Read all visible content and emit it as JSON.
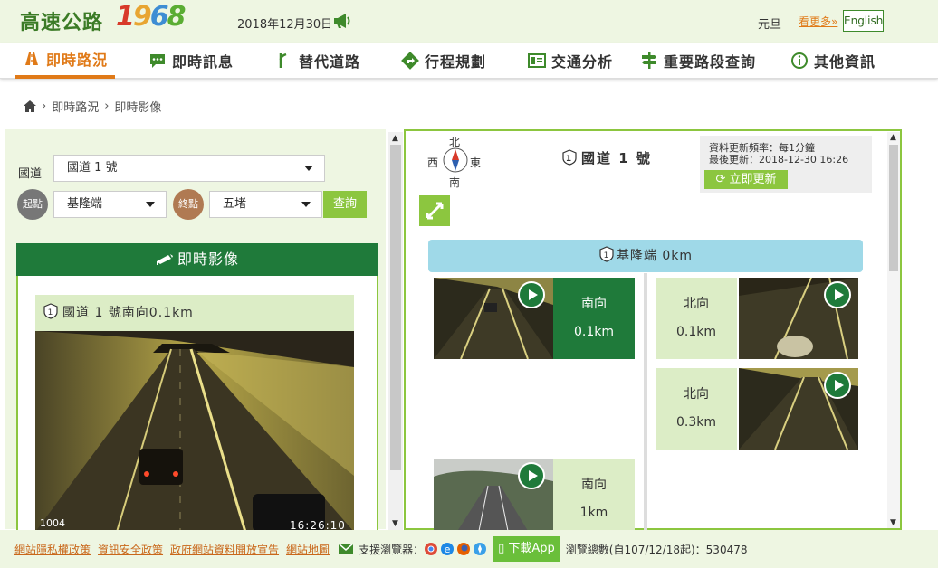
{
  "header": {
    "logo_text": "高速公路",
    "logo_digits": [
      "1",
      "9",
      "6",
      "8"
    ],
    "date": "2018年12月30日",
    "holiday": "元旦",
    "more_link": "看更多»",
    "english_button": "English"
  },
  "nav": {
    "items": [
      {
        "label": "即時路況",
        "icon": "road-icon"
      },
      {
        "label": "即時訊息",
        "icon": "message-icon"
      },
      {
        "label": "替代道路",
        "icon": "fork-icon"
      },
      {
        "label": "行程規劃",
        "icon": "route-icon"
      },
      {
        "label": "交通分析",
        "icon": "analysis-icon"
      },
      {
        "label": "重要路段查詢",
        "icon": "signpost-icon"
      },
      {
        "label": "其他資訊",
        "icon": "info-icon"
      }
    ]
  },
  "breadcrumb": {
    "items": [
      "即時路況",
      "即時影像"
    ]
  },
  "filter": {
    "highway_label": "國道",
    "highway_value": "國道 1 號",
    "start_badge": "起點",
    "start_value": "基隆端",
    "end_badge": "終點",
    "end_value": "五堵",
    "query_button": "查詢"
  },
  "live_panel": {
    "heading": "即時影像",
    "camera_title": "國道 1 號南向0.1km",
    "camera_id": "1004",
    "camera_time": "16:26:10"
  },
  "right_panel": {
    "compass": {
      "n": "北",
      "s": "南",
      "w": "西",
      "e": "東"
    },
    "road_title": "國道 1 號",
    "update_freq": "資料更新頻率：每1分鐘",
    "last_update": "最後更新：2018-12-30 16:26",
    "update_button": "立即更新",
    "start_point": "基隆端 0km",
    "cameras": [
      {
        "direction": "南向",
        "km": "0.1km",
        "style": "dark"
      },
      {
        "direction": "北向",
        "km": "0.1km",
        "style": "light"
      },
      {
        "direction": "北向",
        "km": "0.3km",
        "style": "light"
      },
      {
        "direction": "南向",
        "km": "1km",
        "style": "light"
      }
    ]
  },
  "footer": {
    "links": [
      "網站隱私權政策",
      "資訊安全政策",
      "政府網站資料開放宣告",
      "網站地圖"
    ],
    "browser_label": "支援瀏覽器：",
    "app_button": "下載App",
    "visits": "瀏覽總數(自107/12/18起)：530478"
  },
  "colors": {
    "brand_green": "#1f7a3a",
    "accent_orange": "#e07a18",
    "light_green": "#8cc63f",
    "pale_green": "#eef6e2"
  }
}
